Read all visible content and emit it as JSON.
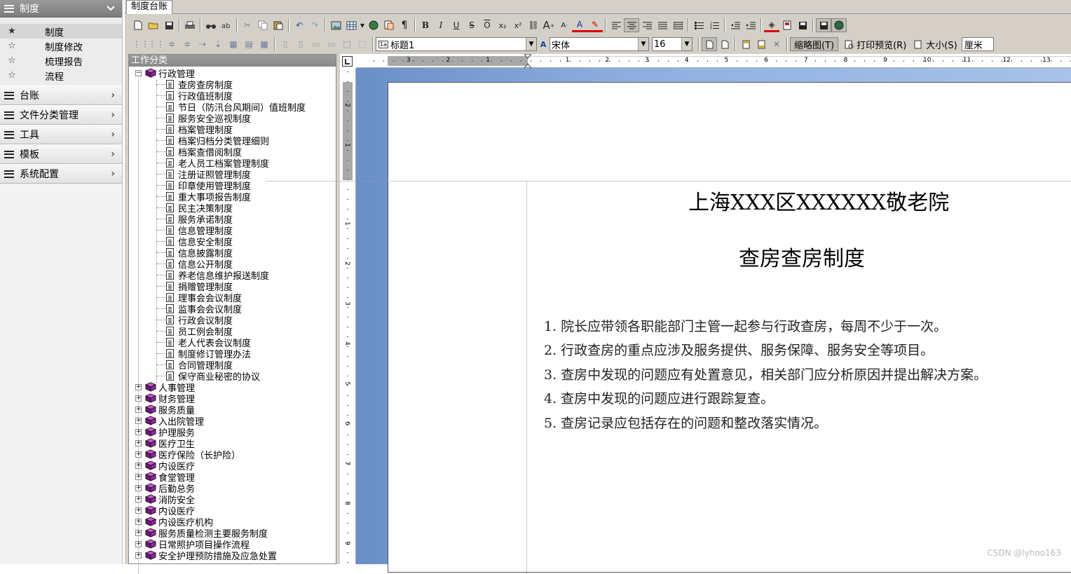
{
  "leftnav": {
    "header": "制度",
    "subitems": [
      {
        "label": "制度",
        "active": true
      },
      {
        "label": "制度修改",
        "active": false
      },
      {
        "label": "梳理报告",
        "active": false
      },
      {
        "label": "流程",
        "active": false
      }
    ],
    "groups": [
      "台账",
      "文件分类管理",
      "工具",
      "模板",
      "系统配置"
    ]
  },
  "tab": {
    "label": "制度台账"
  },
  "toolbar2": {
    "style_value": "标题1",
    "font_value": "宋体",
    "size_value": "16",
    "thumbnail_label": "缩略图(T)",
    "print_preview_label": "打印预览(R)",
    "size_label": "大小(S)",
    "unit_label": "厘米"
  },
  "tree": {
    "header": "工作分类",
    "expanded": {
      "label": "行政管理",
      "children": [
        "查房查房制度",
        "行政值班制度",
        "节日（防汛台风期间）值班制度",
        "服务安全巡视制度",
        "档案管理制度",
        "档案归档分类管理细则",
        "档案查借阅制度",
        "老人员工档案管理制度",
        "注册证照管理制度",
        "印章使用管理制度",
        "重大事项报告制度",
        "民主决策制度",
        "服务承诺制度",
        "信息管理制度",
        "信息安全制度",
        "信息披露制度",
        "信息公开制度",
        "养老信息维护报送制度",
        "捐赠管理制度",
        "理事会会议制度",
        "监事会会议制度",
        "行政会议制度",
        "员工例会制度",
        "老人代表会议制度",
        "制度修订管理办法",
        "合同管理制度",
        "保守商业秘密的协议"
      ]
    },
    "collapsed": [
      "人事管理",
      "财务管理",
      "服务质量",
      "入出院管理",
      "护理服务",
      "医疗卫生",
      "医疗保险（长护险）",
      "内设医疗",
      "食堂管理",
      "后勤总务",
      "消防安全",
      "内设医疗",
      "内设医疗机构",
      "服务质量检测主要服务制度",
      "日常照护项目操作流程",
      "安全护理预防措施及应急处置"
    ]
  },
  "ruler": {
    "h_numbers": [
      "3",
      "2",
      "1",
      "1",
      "2",
      "3",
      "4",
      "5",
      "6",
      "7",
      "8",
      "9",
      "10",
      "11",
      "12",
      "13"
    ],
    "v_numbers": [
      "2",
      "1",
      "1",
      "2",
      "3",
      "4",
      "5",
      "6",
      "7",
      "8",
      "9"
    ]
  },
  "document": {
    "org_title": "上海XXX区XXXXXX敬老院",
    "doc_title": "查房查房制度",
    "items": [
      "1. 院长应带领各职能部门主管一起参与行政查房，每周不少于一次。",
      "2. 行政查房的重点应涉及服务提供、服务保障、服务安全等项目。",
      "3. 查房中发现的问题应有处置意见，相关部门应分析原因并提出解决方案。",
      "4. 查房中发现的问题应进行跟踪复查。",
      "5. 查房记录应包括存在的问题和整改落实情况。"
    ]
  },
  "watermark": "CSDN @lyhoo163"
}
